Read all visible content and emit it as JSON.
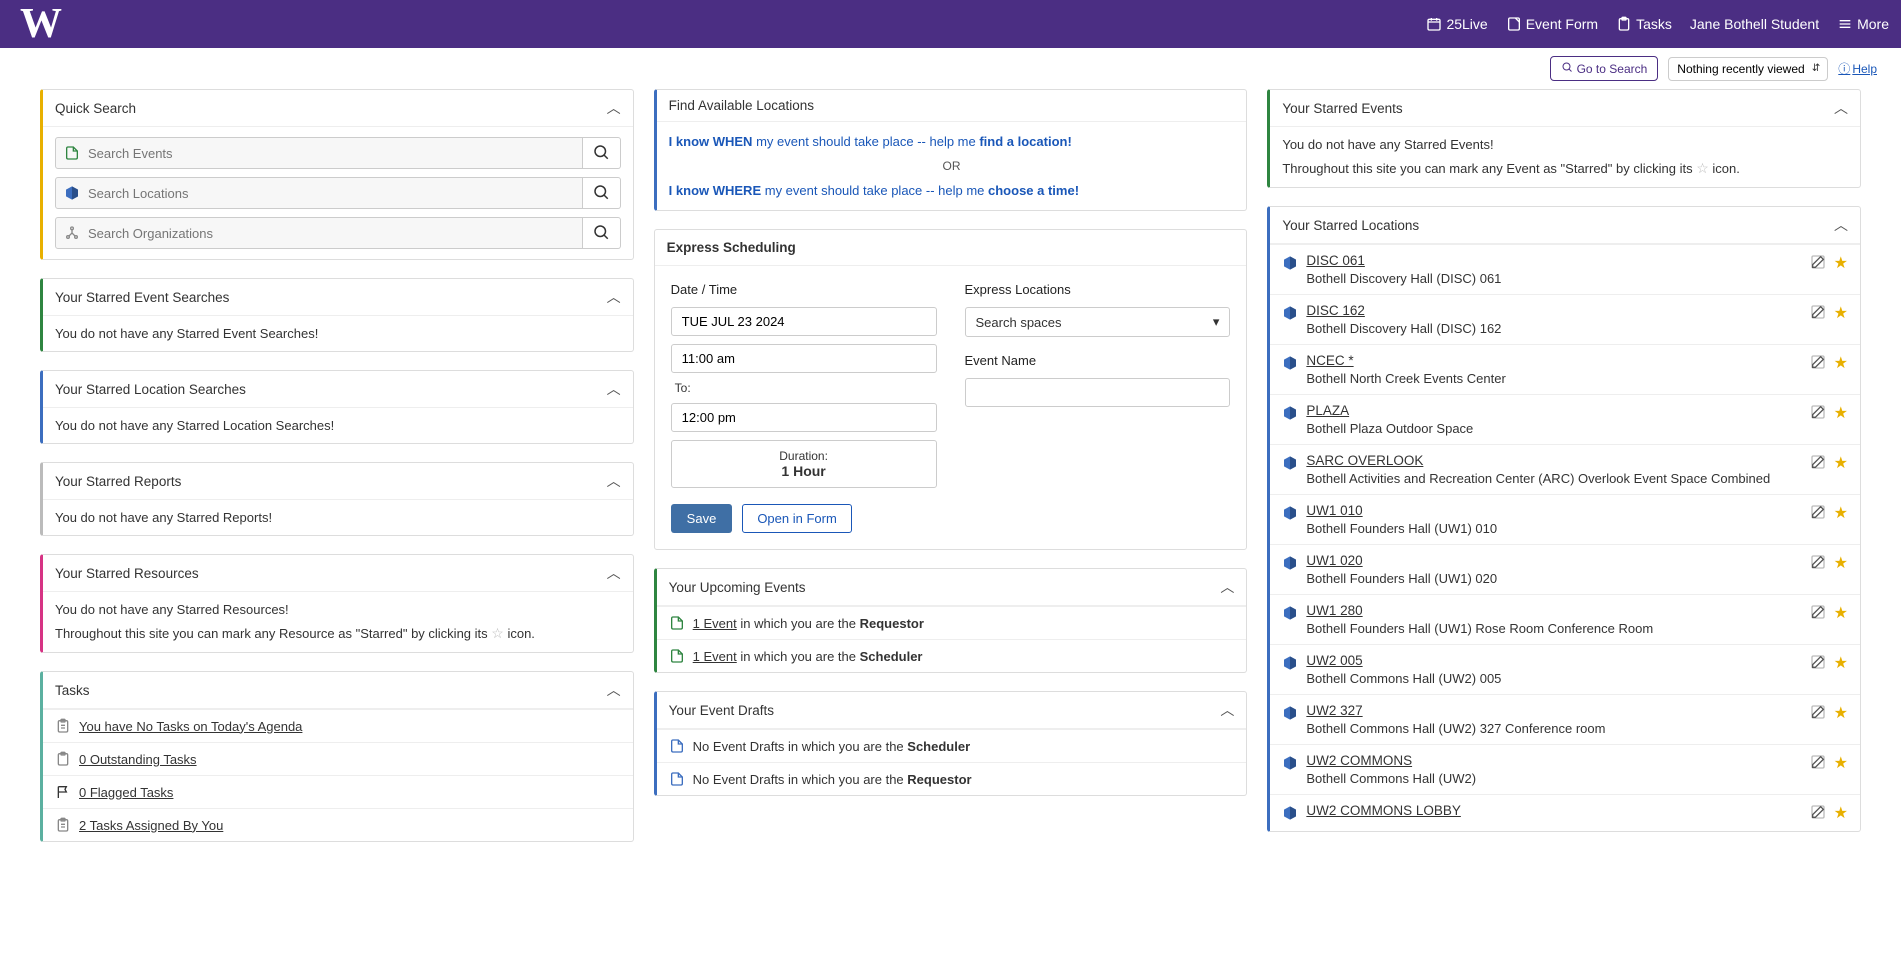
{
  "topbar": {
    "brand": "25Live",
    "event_form": "Event Form",
    "tasks": "Tasks",
    "user": "Jane Bothell Student",
    "more": "More"
  },
  "subbar": {
    "goto_search": "Go to Search",
    "recent": "Nothing recently viewed",
    "help": "Help"
  },
  "quick_search": {
    "title": "Quick Search",
    "events_ph": "Search Events",
    "locations_ph": "Search Locations",
    "orgs_ph": "Search Organizations"
  },
  "starred_event_searches": {
    "title": "Your Starred Event Searches",
    "empty": "You do not have any Starred Event Searches!"
  },
  "starred_location_searches": {
    "title": "Your Starred Location Searches",
    "empty": "You do not have any Starred Location Searches!"
  },
  "starred_reports": {
    "title": "Your Starred Reports",
    "empty": "You do not have any Starred Reports!"
  },
  "starred_resources": {
    "title": "Your Starred Resources",
    "empty": "You do not have any Starred Resources!",
    "hint_pre": "Throughout this site you can mark any Resource as \"Starred\" by clicking its ",
    "hint_post": " icon."
  },
  "tasks_panel": {
    "title": "Tasks",
    "agenda": "You have No Tasks on Today's Agenda",
    "outstanding": "0 Outstanding Tasks",
    "flagged": "0 Flagged Tasks",
    "assigned": "2 Tasks Assigned By You"
  },
  "fal": {
    "title": "Find Available Locations",
    "when_pre": "I know WHEN",
    "when_mid": " my event should take place -- help me ",
    "when_post": "find a location!",
    "or": "OR",
    "where_pre": "I know WHERE",
    "where_mid": " my event should take place -- help me ",
    "where_post": "choose a time!"
  },
  "express": {
    "title": "Express Scheduling",
    "datetime_label": "Date / Time",
    "date": "TUE JUL 23 2024",
    "start": "11:00 am",
    "to": "To:",
    "end": "12:00 pm",
    "duration_label": "Duration:",
    "duration_value": "1 Hour",
    "locations_label": "Express Locations",
    "locations_select": "Search spaces",
    "eventname_label": "Event Name",
    "save": "Save",
    "open_form": "Open in Form"
  },
  "upcoming": {
    "title": "Your Upcoming Events",
    "requestor_link": "1 Event",
    "requestor_mid": " in which you are the ",
    "requestor_role": "Requestor",
    "scheduler_link": "1 Event",
    "scheduler_mid": " in which you are the ",
    "scheduler_role": "Scheduler"
  },
  "drafts": {
    "title": "Your Event Drafts",
    "scheduler_pre": "No Event Drafts in which you are the ",
    "scheduler_role": "Scheduler",
    "requestor_pre": "No Event Drafts in which you are the ",
    "requestor_role": "Requestor"
  },
  "starred_events": {
    "title": "Your Starred Events",
    "empty": "You do not have any Starred Events!",
    "hint_pre": "Throughout this site you can mark any Event as \"Starred\" by clicking its ",
    "hint_post": " icon."
  },
  "starred_locations": {
    "title": "Your Starred Locations",
    "items": [
      {
        "name": "DISC 061",
        "desc": "Bothell Discovery Hall (DISC) 061"
      },
      {
        "name": "DISC 162",
        "desc": "Bothell Discovery Hall (DISC) 162"
      },
      {
        "name": "NCEC *",
        "desc": "Bothell North Creek Events Center"
      },
      {
        "name": "PLAZA",
        "desc": "Bothell Plaza Outdoor Space"
      },
      {
        "name": "SARC OVERLOOK",
        "desc": "Bothell Activities and Recreation Center (ARC) Overlook Event Space Combined"
      },
      {
        "name": "UW1 010",
        "desc": "Bothell Founders Hall (UW1) 010"
      },
      {
        "name": "UW1 020",
        "desc": "Bothell Founders Hall (UW1) 020"
      },
      {
        "name": "UW1 280",
        "desc": "Bothell Founders Hall (UW1) Rose Room Conference Room"
      },
      {
        "name": "UW2 005",
        "desc": "Bothell Commons Hall (UW2) 005"
      },
      {
        "name": "UW2 327",
        "desc": "Bothell Commons Hall (UW2) 327 Conference room"
      },
      {
        "name": "UW2 COMMONS",
        "desc": "Bothell Commons Hall (UW2)"
      },
      {
        "name": "UW2 COMMONS LOBBY",
        "desc": ""
      }
    ]
  }
}
